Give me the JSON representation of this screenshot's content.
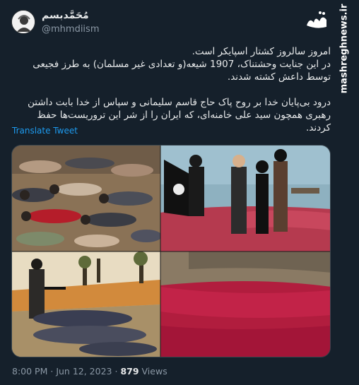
{
  "author": {
    "display_name": "مُحَمَّدبسم",
    "handle": "@mhmdiism",
    "avatar_icon": "avatar-image"
  },
  "watermark": {
    "logo_text": "مشرق",
    "url": "mashreghnews.ir"
  },
  "tweet": {
    "paragraph_1": "امروز سالروز کشتار اسپایکر است.\nدر این جنایت وحشتناک، 1907 شیعه(و تعدادی غیر مسلمان) به طرز فجیعی توسط داعش کشته شدند.",
    "paragraph_2": "درود بی‌پایان خدا بر روح پاک حاج قاسم سلیمانی و سپاس از خدا بابت داشتن رهبری همچون سید علی خامنه‌ای، که ایران را از شر این تروریست‌ها حفظ کردند.",
    "translate_label": "Translate Tweet"
  },
  "footer": {
    "time": "8:00 PM",
    "separator_1": "·",
    "date": "Jun 12, 2023",
    "separator_2": "·",
    "views_count": "879",
    "views_label": "Views"
  },
  "colors": {
    "background": "#15202b",
    "text": "#e7e9ea",
    "secondary": "#8b98a5",
    "link": "#1d9bf0"
  }
}
